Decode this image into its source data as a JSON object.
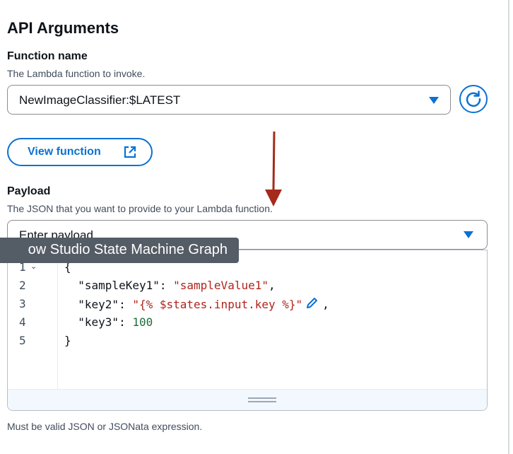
{
  "section": {
    "heading": "API Arguments"
  },
  "function_name": {
    "label": "Function name",
    "description": "The Lambda function to invoke.",
    "selected_value": "NewImageClassifier:$LATEST",
    "view_button_label": "View function"
  },
  "payload": {
    "label": "Payload",
    "description": "The JSON that you want to provide to your Lambda function.",
    "select_placeholder": "Enter payload",
    "line_numbers": [
      "1",
      "2",
      "3",
      "4",
      "5"
    ],
    "lines": {
      "l1": "{",
      "l2_key": "\"sampleKey1\"",
      "l2_sep": ": ",
      "l2_val": "\"sampleValue1\"",
      "l2_end": ",",
      "l3_key": "\"key2\"",
      "l3_sep": ": ",
      "l3_val": "\"{% $states.input.key %}\"",
      "l3_end": ",",
      "l4_key": "\"key3\"",
      "l4_sep": ": ",
      "l4_val": "100",
      "l5": "}"
    },
    "hint": "Must be valid JSON or JSONata expression."
  },
  "tooltip": {
    "text": "ow Studio State Machine Graph"
  },
  "colors": {
    "accent": "#0972d3",
    "arrow": "#a52a1a",
    "string": "#b0241c",
    "number": "#1e6b3a"
  }
}
